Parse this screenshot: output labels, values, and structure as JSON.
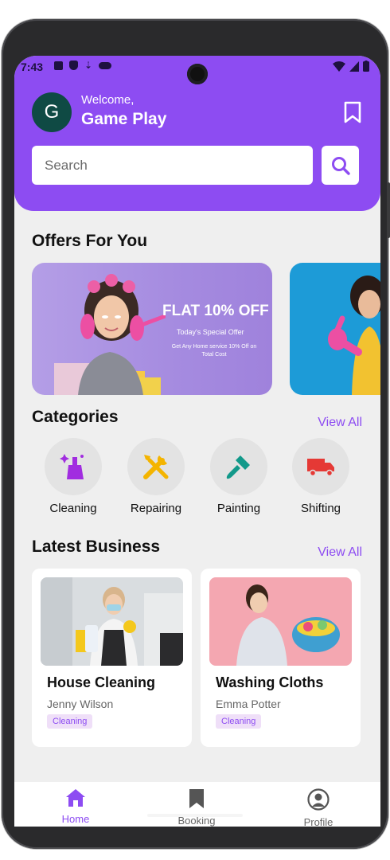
{
  "status_bar": {
    "time": "7:43"
  },
  "header": {
    "avatar_initial": "G",
    "welcome": "Welcome,",
    "user_name": "Game Play"
  },
  "search": {
    "placeholder": "Search"
  },
  "offers": {
    "title": "Offers For You",
    "cards": [
      {
        "heading": "FLAT 10% OFF",
        "subheading": "Today's Special Offer",
        "description": "Get Any Home service 10% Off on Total Cost"
      }
    ]
  },
  "categories": {
    "title": "Categories",
    "view_all": "View All",
    "items": [
      {
        "label": "Cleaning",
        "icon": "cleaning-icon",
        "color": "#a12de0"
      },
      {
        "label": "Repairing",
        "icon": "tools-icon",
        "color": "#f4b400"
      },
      {
        "label": "Painting",
        "icon": "paint-brush-icon",
        "color": "#12998a"
      },
      {
        "label": "Shifting",
        "icon": "truck-icon",
        "color": "#e53935"
      }
    ]
  },
  "latest_business": {
    "title": "Latest Business",
    "view_all": "View All",
    "items": [
      {
        "title": "House Cleaning",
        "owner": "Jenny Wilson",
        "tag": "Cleaning"
      },
      {
        "title": "Washing Cloths",
        "owner": "Emma Potter",
        "tag": "Cleaning"
      }
    ]
  },
  "bottom_nav": {
    "items": [
      {
        "label": "Home",
        "icon": "home-icon",
        "active": true
      },
      {
        "label": "Booking",
        "icon": "bookmark-icon",
        "active": false
      },
      {
        "label": "Profile",
        "icon": "profile-icon",
        "active": false
      }
    ]
  },
  "colors": {
    "primary": "#8d4cf2",
    "avatar_bg": "#0f4a44",
    "background": "#efefef",
    "tag_bg": "#efdff8"
  }
}
